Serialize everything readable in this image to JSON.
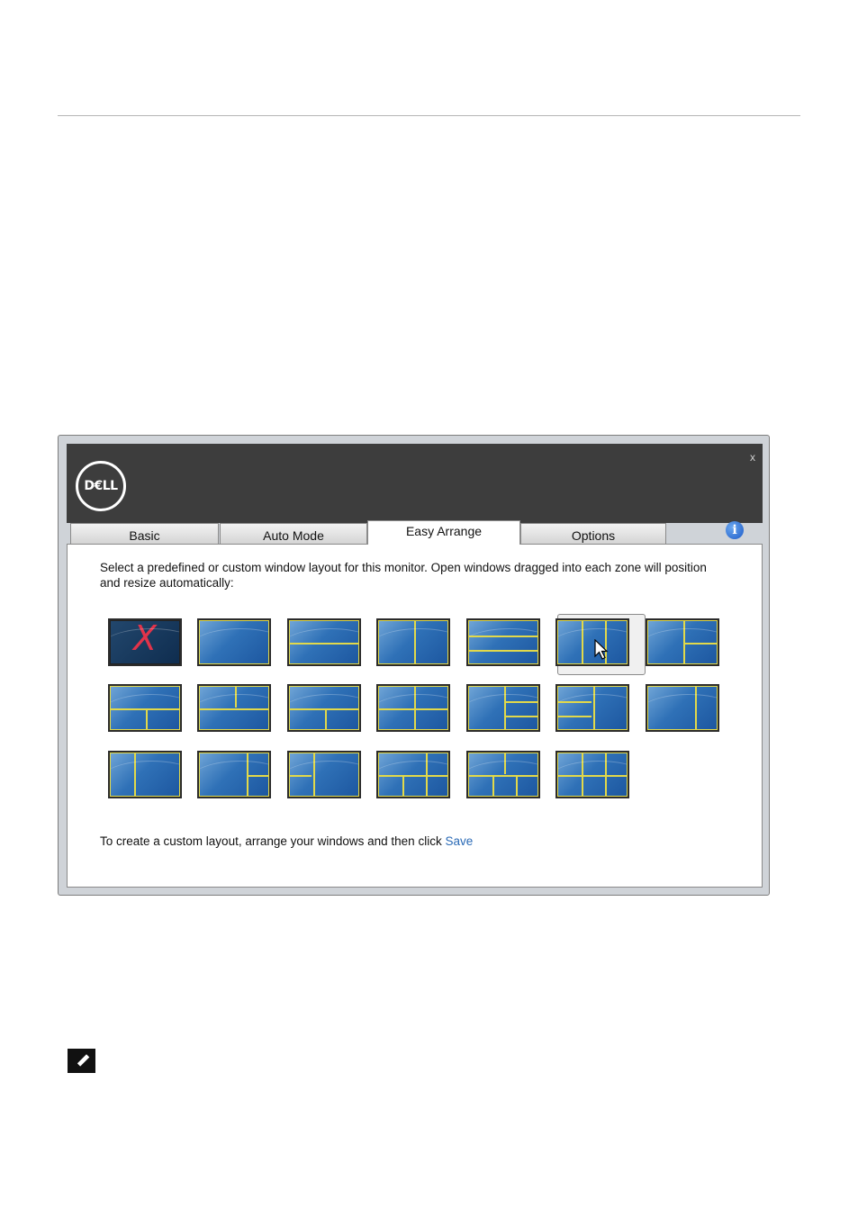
{
  "app": {
    "logo_text": "D€LL",
    "close_label": "x",
    "tabs": [
      {
        "label": "Basic",
        "active": false
      },
      {
        "label": "Auto Mode",
        "active": false
      },
      {
        "label": "Easy Arrange",
        "active": true
      },
      {
        "label": "Options",
        "active": false
      }
    ],
    "info_label": "i",
    "description": "Select a predefined or custom window layout for this monitor. Open windows dragged into each zone will position and resize automatically:",
    "footer_text": "To create a custom layout, arrange your windows and then click ",
    "save_link": "Save",
    "selected_layout_index": 5
  },
  "colors": {
    "zone_line": "#e2d94a",
    "accent": "#2a6ab6",
    "titlebar": "#3d3d3d"
  },
  "icons": [
    "dell-logo",
    "close-icon",
    "info-icon",
    "disabled-x-icon",
    "mouse-cursor-icon",
    "note-pencil-icon"
  ]
}
